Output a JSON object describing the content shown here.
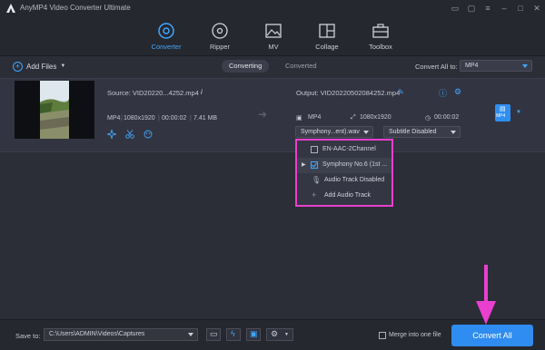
{
  "app": {
    "title": "AnyMP4 Video Converter Ultimate"
  },
  "nav": {
    "tabs": [
      {
        "label": "Converter",
        "icon": "converter-icon",
        "active": true
      },
      {
        "label": "Ripper",
        "icon": "disc-icon"
      },
      {
        "label": "MV",
        "icon": "image-icon"
      },
      {
        "label": "Collage",
        "icon": "collage-icon"
      },
      {
        "label": "Toolbox",
        "icon": "toolbox-icon"
      }
    ]
  },
  "toolbar": {
    "add_files": "Add Files",
    "seg_converting": "Converting",
    "seg_converted": "Converted",
    "convert_all_to": "Convert All to:",
    "convert_all_format": "MP4"
  },
  "file": {
    "source": "Source: VID20220...4252.mp4",
    "format": "MP4",
    "resolution": "1080x1920",
    "duration": "00:00:02",
    "size": "7.41 MB",
    "output": "Output: VID20220502084252.mp4",
    "out_format": "MP4",
    "out_resolution": "1080x1920",
    "out_duration": "00:00:02",
    "audio_select": "Symphony...ent).wav",
    "subtitle_select": "Subtitle Disabled",
    "format_badge": "MP4"
  },
  "audio_dropdown": {
    "items": [
      "EN-AAC-2Channel",
      "Symphony No.6 (1st ...",
      "Audio Track Disabled",
      "Add Audio Track"
    ]
  },
  "bottom": {
    "save_to": "Save to:",
    "path": "C:\\Users\\ADMIN\\Videos\\Captures",
    "merge": "Merge into one file",
    "convert_all": "Convert All"
  },
  "colors": {
    "accent": "#3fa7ff",
    "highlight": "#e93fcf",
    "button": "#2f8cf0"
  }
}
